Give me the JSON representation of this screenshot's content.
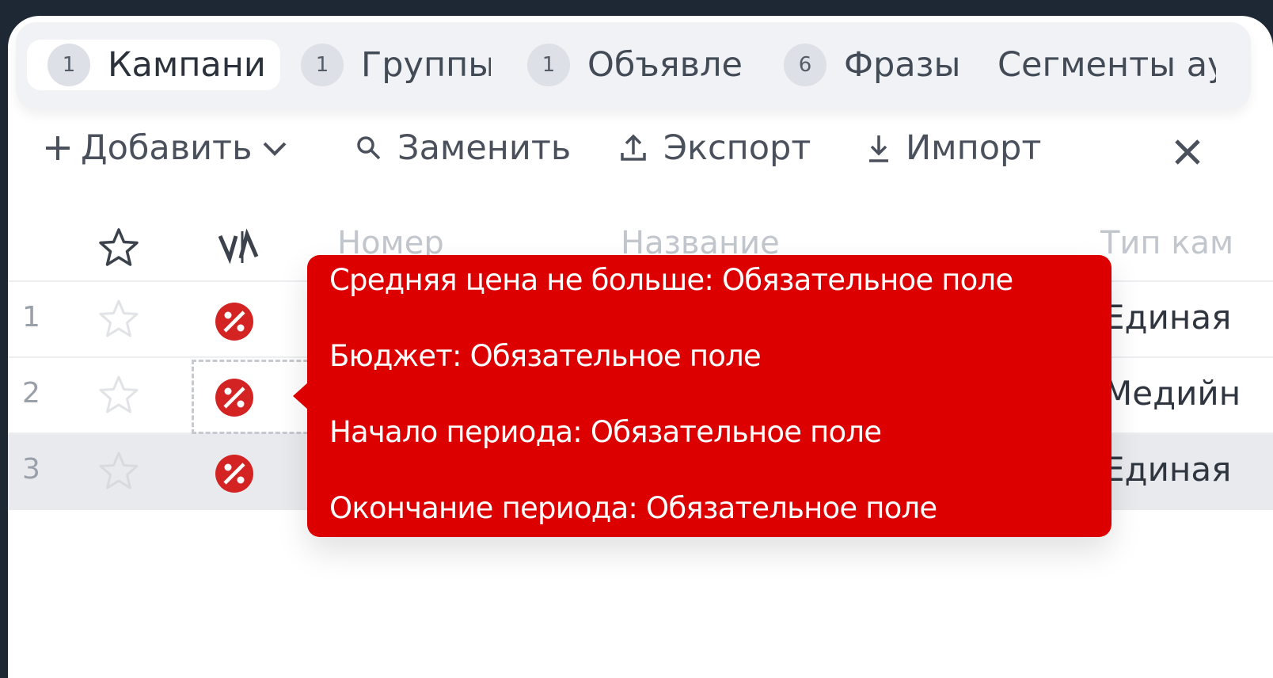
{
  "tabs": [
    {
      "count": "1",
      "label": "Кампани",
      "active": true
    },
    {
      "count": "1",
      "label": "Группы"
    },
    {
      "count": "1",
      "label": "Объявле"
    },
    {
      "count": "6",
      "label": "Фразы"
    },
    {
      "label": "Сегменты ау,"
    }
  ],
  "toolbar": {
    "add_label": "Добавить",
    "replace_label": "Заменить",
    "export_label": "Экспорт",
    "import_label": "Импорт"
  },
  "table": {
    "columns": {
      "number": "Номер",
      "name": "Название",
      "type": "Тип кам"
    },
    "rows": [
      {
        "num": "1",
        "type": "Единая"
      },
      {
        "num": "2",
        "type": "Медийн"
      },
      {
        "num": "3",
        "type": "Единая"
      }
    ]
  },
  "tooltip": {
    "lines": [
      "Средняя цена не больше: Обязательное поле",
      "Бюджет: Обязательное поле",
      "Начало периода: Обязательное поле",
      "Окончание периода: Обязательное поле"
    ]
  },
  "colors": {
    "error": "#dd0000",
    "accent_bg": "#f1f2f5",
    "text": "#434b57"
  }
}
